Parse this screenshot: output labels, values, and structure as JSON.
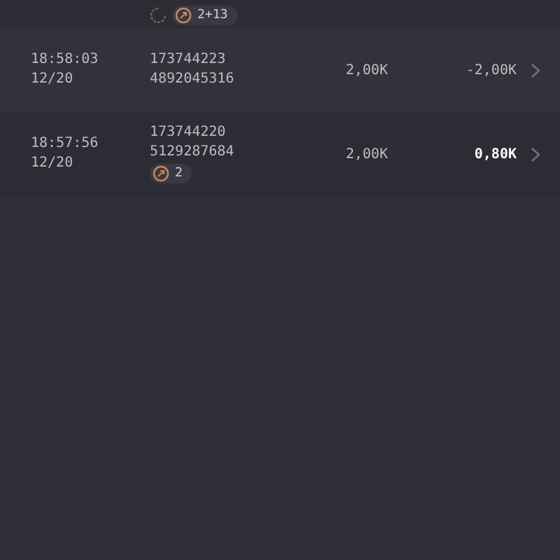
{
  "rows": [
    {
      "time": null,
      "date": null,
      "ids": [],
      "pending": true,
      "badge": "2+13",
      "amount": null,
      "result": null
    },
    {
      "time": "18:58:03",
      "date": "12/20",
      "ids": [
        "173744223",
        "4892045316"
      ],
      "amount": "2,00K",
      "result": "-2,00K",
      "emphasis": false
    },
    {
      "time": "18:57:56",
      "date": "12/20",
      "ids": [
        "173744220",
        "5129287684"
      ],
      "badge": "2",
      "amount": "2,00K",
      "result": "0,80K",
      "emphasis": true
    }
  ]
}
